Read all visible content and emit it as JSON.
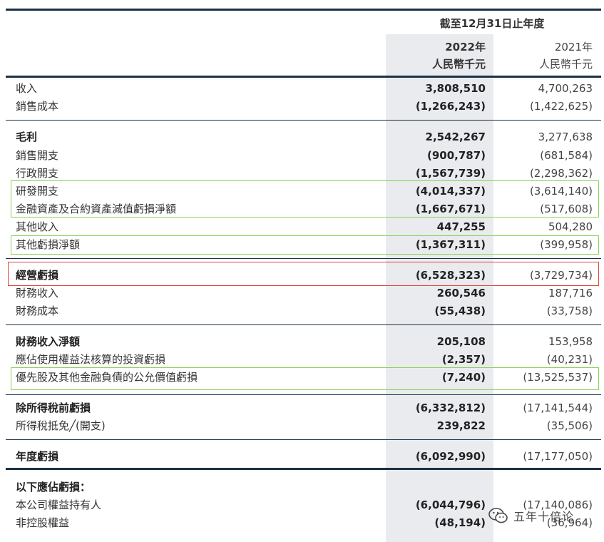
{
  "header": {
    "period": "截至12月31日止年度",
    "columns": [
      {
        "year": "2022年",
        "unit": "人民幣千元"
      },
      {
        "year": "2021年",
        "unit": "人民幣千元"
      }
    ]
  },
  "rows": [
    {
      "label": "收入",
      "current": "3,808,510",
      "prior": "4,700,263"
    },
    {
      "label": "銷售成本",
      "current": "(1,266,243)",
      "prior": "(1,422,625)"
    },
    {
      "label": "毛利",
      "current": "2,542,267",
      "prior": "3,277,638"
    },
    {
      "label": "銷售開支",
      "current": "(900,787)",
      "prior": "(681,584)"
    },
    {
      "label": "行政開支",
      "current": "(1,567,739)",
      "prior": "(2,298,362)"
    },
    {
      "label": "研發開支",
      "current": "(4,014,337)",
      "prior": "(3,614,140)"
    },
    {
      "label": "金融資產及合約資產減值虧損淨額",
      "current": "(1,667,671)",
      "prior": "(517,608)"
    },
    {
      "label": "其他收入",
      "current": "447,255",
      "prior": "504,280"
    },
    {
      "label": "其他虧損淨額",
      "current": "(1,367,311)",
      "prior": "(399,958)"
    },
    {
      "label": "經營虧損",
      "current": "(6,528,323)",
      "prior": "(3,729,734)"
    },
    {
      "label": "財務收入",
      "current": "260,546",
      "prior": "187,716"
    },
    {
      "label": "財務成本",
      "current": "(55,438)",
      "prior": "(33,758)"
    },
    {
      "label": "財務收入淨額",
      "current": "205,108",
      "prior": "153,958"
    },
    {
      "label": "應佔使用權益法核算的投資虧損",
      "current": "(2,357)",
      "prior": "(40,231)"
    },
    {
      "label": "優先股及其他金融負債的公允價值虧損",
      "current": "(7,240)",
      "prior": "(13,525,537)"
    },
    {
      "label": "除所得稅前虧損",
      "current": "(6,332,812)",
      "prior": "(17,141,544)"
    },
    {
      "label": "所得稅抵免╱(開支)",
      "current": "239,822",
      "prior": "(35,506)"
    },
    {
      "label": "年度虧損",
      "current": "(6,092,990)",
      "prior": "(17,177,050)"
    },
    {
      "label": "以下應佔虧損：",
      "current": "",
      "prior": ""
    },
    {
      "label": "本公司權益持有人",
      "current": "(6,044,796)",
      "prior": "(17,140,086)"
    },
    {
      "label": "非控股權益",
      "current": "(48,194)",
      "prior": "(36,964)"
    }
  ],
  "watermark": {
    "text": "五年十倍论",
    "icon": "wechat-icon"
  },
  "colors": {
    "rule": "#1c3146",
    "shade": "#e9ebee",
    "highlight_green": "#8cd15a",
    "highlight_red": "#e0453a"
  }
}
